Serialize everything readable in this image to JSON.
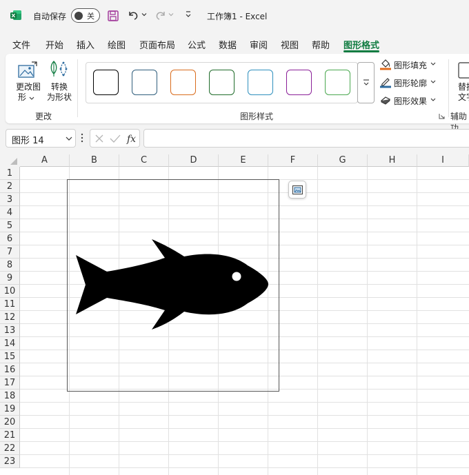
{
  "titlebar": {
    "autosave_label": "自动保存",
    "autosave_state": "关",
    "doc_title": "工作簿1  -  Excel"
  },
  "menu": {
    "tabs": [
      "文件",
      "开始",
      "插入",
      "绘图",
      "页面布局",
      "公式",
      "数据",
      "审阅",
      "视图",
      "帮助",
      "图形格式"
    ],
    "active": "图形格式"
  },
  "ribbon": {
    "change_shape_label_1": "更改图",
    "change_shape_label_2": "形",
    "convert_label_1": "转换",
    "convert_label_2": "为形状",
    "group_change": "更改",
    "group_shape_styles": "图形样式",
    "group_accessibility": "辅助功",
    "alt_text_label_1": "替换",
    "alt_text_label_2": "文字",
    "style_colors": [
      "#000000",
      "#2f5d7c",
      "#d96b1c",
      "#1f6b2a",
      "#2d8fbd",
      "#8a1f98",
      "#4aa84f"
    ],
    "fill_label": "图形填充",
    "outline_label": "图形轮廓",
    "effects_label": "图形效果",
    "fill_accent": "#e06c1e",
    "outline_accent": "#2d6b9f"
  },
  "formula_bar": {
    "name_box": "图形 14",
    "formula": ""
  },
  "grid": {
    "columns": [
      "A",
      "B",
      "C",
      "D",
      "E",
      "F",
      "G",
      "H",
      "I"
    ],
    "rows": [
      "1",
      "2",
      "3",
      "4",
      "5",
      "6",
      "7",
      "8",
      "9",
      "10",
      "11",
      "12",
      "13",
      "14",
      "15",
      "16",
      "17",
      "18",
      "19",
      "20",
      "21",
      "22",
      "23"
    ]
  },
  "shape": {
    "name": "fish-icon",
    "fill": "#000000"
  }
}
